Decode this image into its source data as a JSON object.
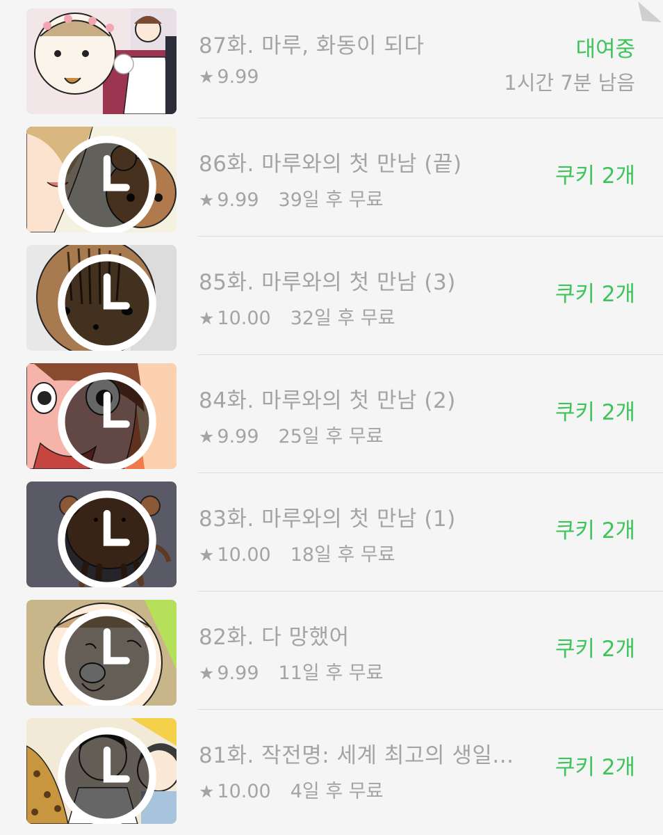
{
  "episodes": [
    {
      "title": "87화. 마루, 화동이 되다",
      "rating": "9.99",
      "free_in": "",
      "status": "대여중",
      "remaining": "1시간 7분 남음",
      "price": ""
    },
    {
      "title": "86화. 마루와의 첫 만남 (끝)",
      "rating": "9.99",
      "free_in": "39일 후 무료",
      "status": "",
      "remaining": "",
      "price": "쿠키 2개"
    },
    {
      "title": "85화. 마루와의 첫 만남 (3)",
      "rating": "10.00",
      "free_in": "32일 후 무료",
      "status": "",
      "remaining": "",
      "price": "쿠키 2개"
    },
    {
      "title": "84화. 마루와의 첫 만남 (2)",
      "rating": "9.99",
      "free_in": "25일 후 무료",
      "status": "",
      "remaining": "",
      "price": "쿠키 2개"
    },
    {
      "title": "83화. 마루와의 첫 만남 (1)",
      "rating": "10.00",
      "free_in": "18일 후 무료",
      "status": "",
      "remaining": "",
      "price": "쿠키 2개"
    },
    {
      "title": "82화. 다 망했어",
      "rating": "9.99",
      "free_in": "11일 후 무료",
      "status": "",
      "remaining": "",
      "price": "쿠키 2개"
    },
    {
      "title": "81화. 작전명: 세계 최고의 생일...",
      "rating": "10.00",
      "free_in": "4일 후 무료",
      "status": "",
      "remaining": "",
      "price": "쿠키 2개"
    }
  ],
  "icons": {
    "star": "star-icon",
    "clock": "clock-icon"
  },
  "colors": {
    "accent_green": "#3dc45a",
    "text_gray": "#a4a4a4",
    "background": "#f5f5f5"
  }
}
